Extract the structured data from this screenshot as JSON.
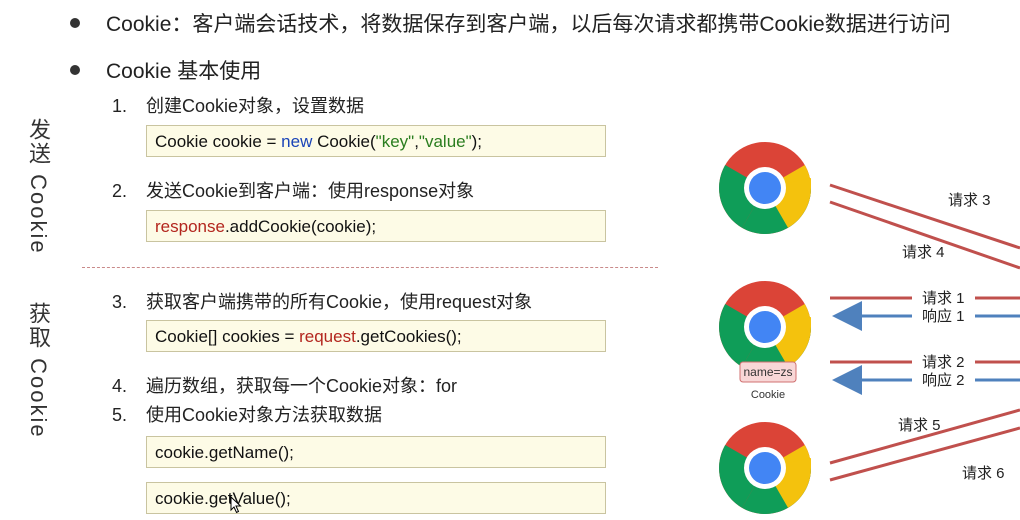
{
  "bullets": [
    {
      "text": "Cookie：客户端会话技术，将数据保存到客户端，以后每次请求都携带Cookie数据进行访问"
    },
    {
      "text": "Cookie 基本使用"
    }
  ],
  "send_side_label": "发送 Cookie",
  "get_side_label": "获取 Cookie",
  "steps": [
    {
      "num": "1.",
      "text": "创建Cookie对象，设置数据"
    },
    {
      "num": "2.",
      "text": "发送Cookie到客户端：使用response对象"
    },
    {
      "num": "3.",
      "text": "获取客户端携带的所有Cookie，使用request对象"
    },
    {
      "num": "4.",
      "text": "遍历数组，获取每一个Cookie对象：for"
    },
    {
      "num": "5.",
      "text": "使用Cookie对象方法获取数据"
    }
  ],
  "code": {
    "c1": {
      "a": "Cookie cookie = ",
      "b": "new",
      "c": " Cookie(",
      "d": "\"key\"",
      "e": ",",
      "f": "\"value\"",
      "g": ");"
    },
    "c2": {
      "a": "response",
      "b": ".addCookie(cookie);"
    },
    "c3": {
      "a": "Cookie[] cookies = ",
      "b": "request",
      "c": ".getCookies();"
    },
    "c4": "cookie.getName();",
    "c5": "cookie.getValue();"
  },
  "diagram": {
    "cookie_tag": "name=zs",
    "cookie_caption": "Cookie",
    "labels": {
      "req3": "请求 3",
      "req4": "请求 4",
      "req1": "请求 1",
      "resp1": "响应 1",
      "req2": "请求 2",
      "resp2": "响应 2",
      "req5": "请求 5",
      "req6": "请求 6"
    }
  },
  "colors": {
    "request_arrow": "#c0504d",
    "response_arrow": "#4f81bd",
    "code_bg": "#fdfbe6"
  }
}
